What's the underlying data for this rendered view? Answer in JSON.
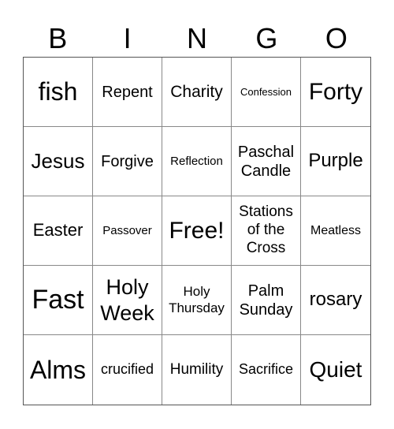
{
  "header": [
    "B",
    "I",
    "N",
    "G",
    "O"
  ],
  "cells": [
    "fish",
    "Repent",
    "Charity",
    "Confession",
    "Forty",
    "Jesus",
    "Forgive",
    "Reflection",
    "Paschal\nCandle",
    "Purple",
    "Easter",
    "Passover",
    "Free!",
    "Stations\nof the\nCross",
    "Meatless",
    "Fast",
    "Holy\nWeek",
    "Holy\nThursday",
    "Palm\nSunday",
    "rosary",
    "Alms",
    "crucified",
    "Humility",
    "Sacrifice",
    "Quiet"
  ]
}
